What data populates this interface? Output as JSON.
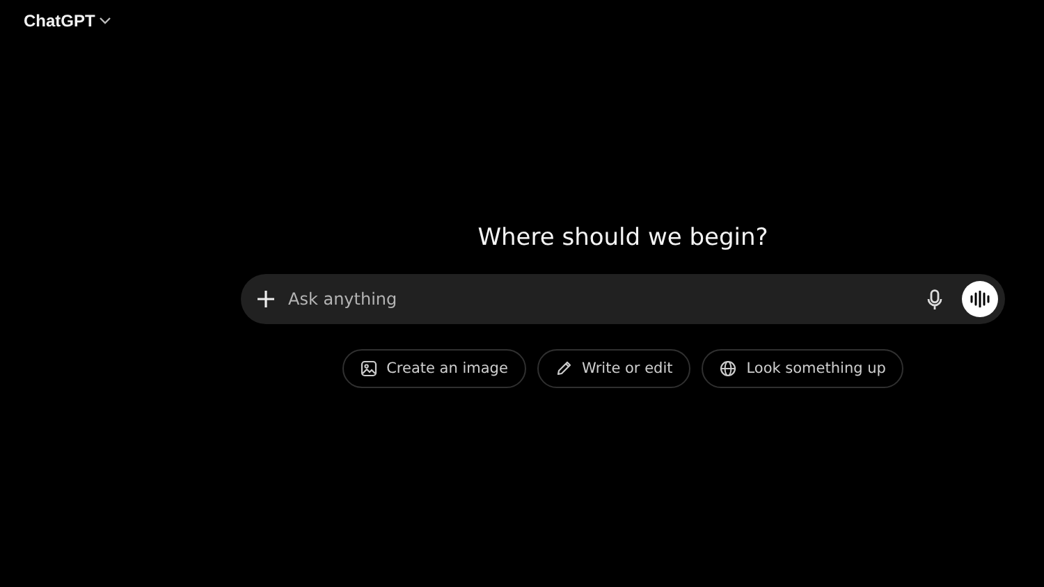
{
  "header": {
    "model_name": "ChatGPT"
  },
  "heading": "Where should we begin?",
  "composer": {
    "placeholder": "Ask anything"
  },
  "suggestions": [
    {
      "label": "Create an image",
      "kind": "image"
    },
    {
      "label": "Write or edit",
      "kind": "pencil"
    },
    {
      "label": "Look something up",
      "kind": "globe"
    }
  ]
}
